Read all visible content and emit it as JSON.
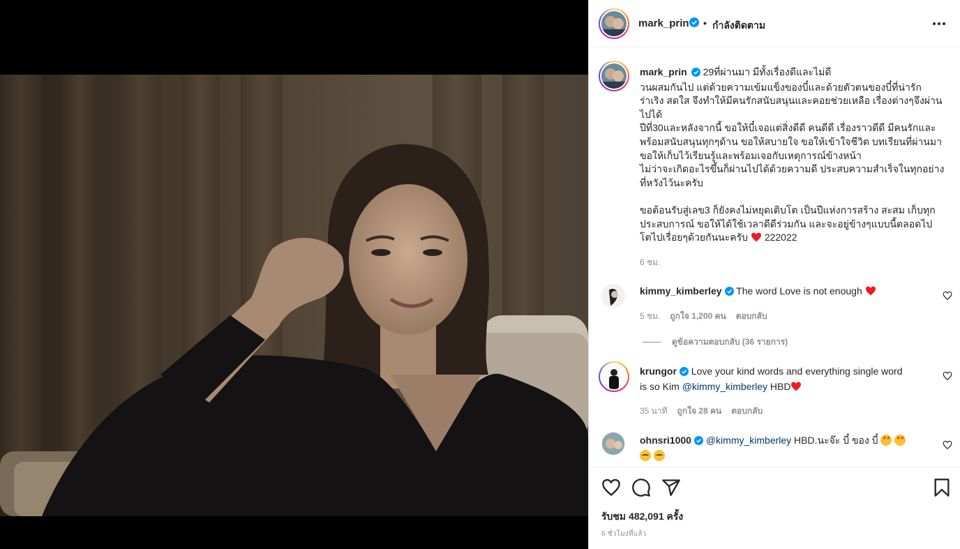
{
  "post": {
    "author": "mark_prin",
    "follow_status": "กำลังติดตาม",
    "separator": "•",
    "caption_lines": [
      "29ที่ผ่านมา มีทั้งเรื่องดีและไม่ดี",
      "วนผสมกันไป แต่ด้วยความเข้มแข็งของบี๋และด้วยตัวตนของบี๋ที่น่ารัก",
      "ร่าเริง สดใส จึงทำให้มีคนรักสนับสนุนและคอยช่วยเหลือ เรื่องต่างๆจึงผ่าน",
      "ไปได้",
      "ปีที่30และหลังจากนี้ ขอให้บี๋เจอแต่สิ่งดีดี คนดีดี เรื่องราวดีดี มีคนรักและ",
      "พร้อมสนับสนุนทุกๆด้าน ขอให้สบายใจ ขอให้เข้าใจชีวิต บทเรียนที่ผ่านมา",
      "ขอให้เก็บไว้เรียนรู้และพร้อมเจอกับเหตุการณ์ข้างหน้า",
      "ไม่ว่าจะเกิดอะไรขึ้นก็ผ่านไปได้ด้วยความดี ประสบความสำเร็จในทุกอย่าง",
      "ที่หวังไว้นะครับ",
      "",
      "ขอต้อนรับสู่เลข3 ก็ยังคงไม่หยุดเติบโต เป็นปีแห่งการสร้าง สะสม เก็บทุก",
      "ประสบการณ์ ขอให้ได้ใช้เวลาดีดีร่วมกัน และจะอยู่ข้างๆแบบนี้ตลอดไป",
      "โตไปเรื่อยๆด้วยกันนะครับ"
    ],
    "caption_tail": "222022",
    "caption_time": "6 ชม.",
    "views_label": "รับชม 482,091 ครั้ง",
    "posted_ago": "6 ชั่วโมงที่แล้ว"
  },
  "comments": [
    {
      "user": "kimmy_kimberley",
      "text": "The word Love is not enough",
      "time": "5 ชม.",
      "likes": "ถูกใจ 1,200 คน",
      "reply": "ตอบกลับ"
    },
    {
      "user": "krungor",
      "text_line1": "Love your kind words and everything single word",
      "text_line2_prefix": "is so Kim ",
      "mention": "@kimmy_kimberley",
      "text_line2_suffix": " HBD",
      "time": "35 นาที",
      "likes": "ถูกใจ 28 คน",
      "reply": "ตอบกลับ"
    },
    {
      "user": "ohnsri1000",
      "mention": "@kimmy_kimberley",
      "text": " HBD.นะจ๊ะ บี๋ ของ บี๋"
    }
  ],
  "view_replies": "ดูข้อความตอบกลับ (36 รายการ)",
  "colors": {
    "verified": "#0095f6",
    "heart_red": "#ed4956",
    "meta_gray": "#8e8e8e",
    "link": "#00376b"
  },
  "icons": [
    "heart-icon",
    "comment-icon",
    "share-icon",
    "bookmark-icon",
    "more-options-icon",
    "verified-badge-icon",
    "like-comment-icon"
  ]
}
